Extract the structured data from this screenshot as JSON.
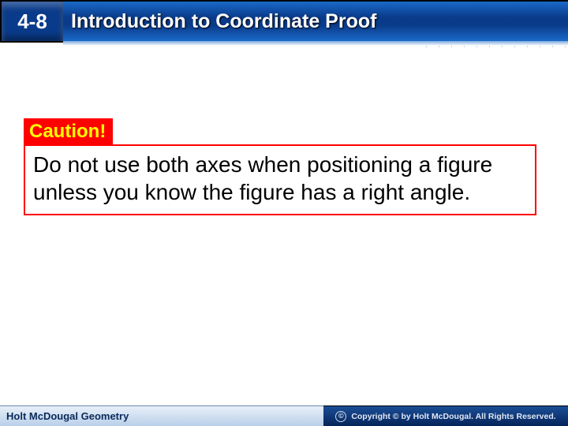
{
  "header": {
    "lesson_number": "4-8",
    "lesson_title": "Introduction to Coordinate Proof"
  },
  "callout": {
    "tag_label": "Caution!",
    "body_text": "Do not use both axes when positioning a figure unless you know the figure has a right angle."
  },
  "footer": {
    "book_title": "Holt McDougal Geometry",
    "copyright_symbol": "©",
    "copyright_text": "Copyright © by Holt McDougal. All Rights Reserved."
  }
}
